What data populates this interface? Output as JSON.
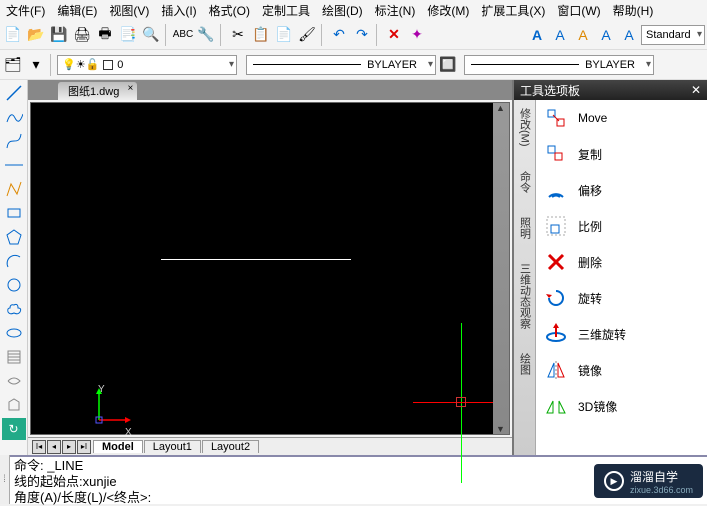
{
  "menu": [
    "文件(F)",
    "编辑(E)",
    "视图(V)",
    "插入(I)",
    "格式(O)",
    "定制工具",
    "绘图(D)",
    "标注(N)",
    "修改(M)",
    "扩展工具(X)",
    "窗口(W)",
    "帮助(H)"
  ],
  "toolbar2": {
    "layer_combo": "0",
    "linetype_left": "BYLAYER",
    "linetype_right": "BYLAYER"
  },
  "style_combo": "Standard",
  "doc_tab": "图纸1.dwg",
  "layout_tabs": [
    "Model",
    "Layout1",
    "Layout2"
  ],
  "axis": {
    "x": "X",
    "y": "Y"
  },
  "right_panel": {
    "title": "工具选项板",
    "side_tabs": [
      "修改(M)",
      "命令",
      "照明",
      "三维动态观察",
      "绘图"
    ],
    "items": [
      {
        "label": "Move"
      },
      {
        "label": "复制"
      },
      {
        "label": "偏移"
      },
      {
        "label": "比例"
      },
      {
        "label": "删除"
      },
      {
        "label": "旋转"
      },
      {
        "label": "三维旋转"
      },
      {
        "label": "镜像"
      },
      {
        "label": "3D镜像"
      }
    ]
  },
  "cmd": {
    "l1": "命令:  _LINE",
    "l2": "线的起始点:xunjie",
    "l3": "角度(A)/长度(L)/<终点>:"
  },
  "watermark": {
    "title": "溜溜自学",
    "sub": "zixue.3d66.com"
  }
}
